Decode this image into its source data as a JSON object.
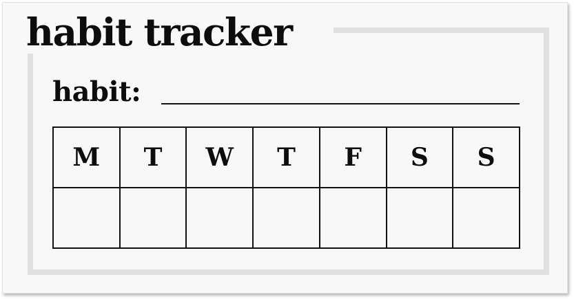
{
  "title": "habit tracker",
  "habit": {
    "label": "habit:",
    "value": ""
  },
  "days": [
    "M",
    "T",
    "W",
    "T",
    "F",
    "S",
    "S"
  ],
  "checks": [
    "",
    "",
    "",
    "",
    "",
    "",
    ""
  ]
}
